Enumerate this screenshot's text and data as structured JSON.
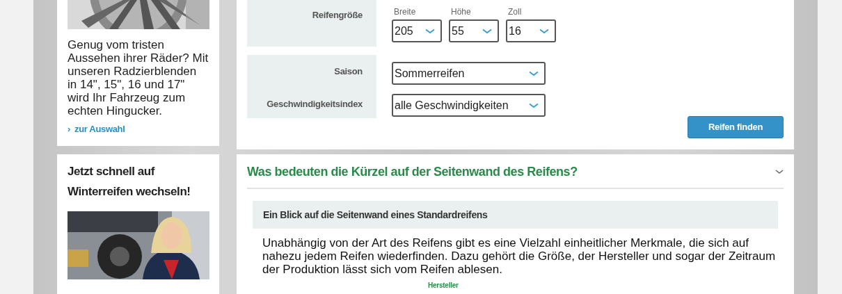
{
  "sidebar": {
    "promo_text": "Genug vom tristen Aussehen ihrer Räder? Mit unseren Radzierblenden in 14\", 15\", 16 und 17\" wird Ihr Fahrzeug zum echten Hingucker.",
    "promo_link_marker": "›",
    "promo_link": "zur Auswahl",
    "winter_heading": "Jetzt schnell auf Winterreifen wechseln!"
  },
  "tire_search": {
    "size_label": "Reifengröße",
    "size_fields": [
      {
        "label": "Breite",
        "value": "205"
      },
      {
        "label": "Höhe",
        "value": "55"
      },
      {
        "label": "Zoll",
        "value": "16"
      }
    ],
    "fields": [
      {
        "label": "Saison",
        "value": "Sommerreifen"
      },
      {
        "label": "Geschwindigkeitsindex",
        "value": "alle Geschwindigkeiten"
      }
    ],
    "submit": "Reifen finden"
  },
  "faq": {
    "title": "Was bedeuten die Kürzel auf der Seitenwand des Reifens?",
    "section_heading": "Ein Blick auf die Seitenwand eines Standardreifens",
    "paragraph": "Unabhängig von der Art des Reifens gibt es eine Vielzahl einheitlicher Merkmale, die sich auf nahezu jedem Reifen wiederfinden. Dazu gehört die Größe, der Hersteller und sogar der Zeitraum der Produktion lässt sich vom Reifen ablesen.",
    "diagram_label": "Hersteller"
  }
}
